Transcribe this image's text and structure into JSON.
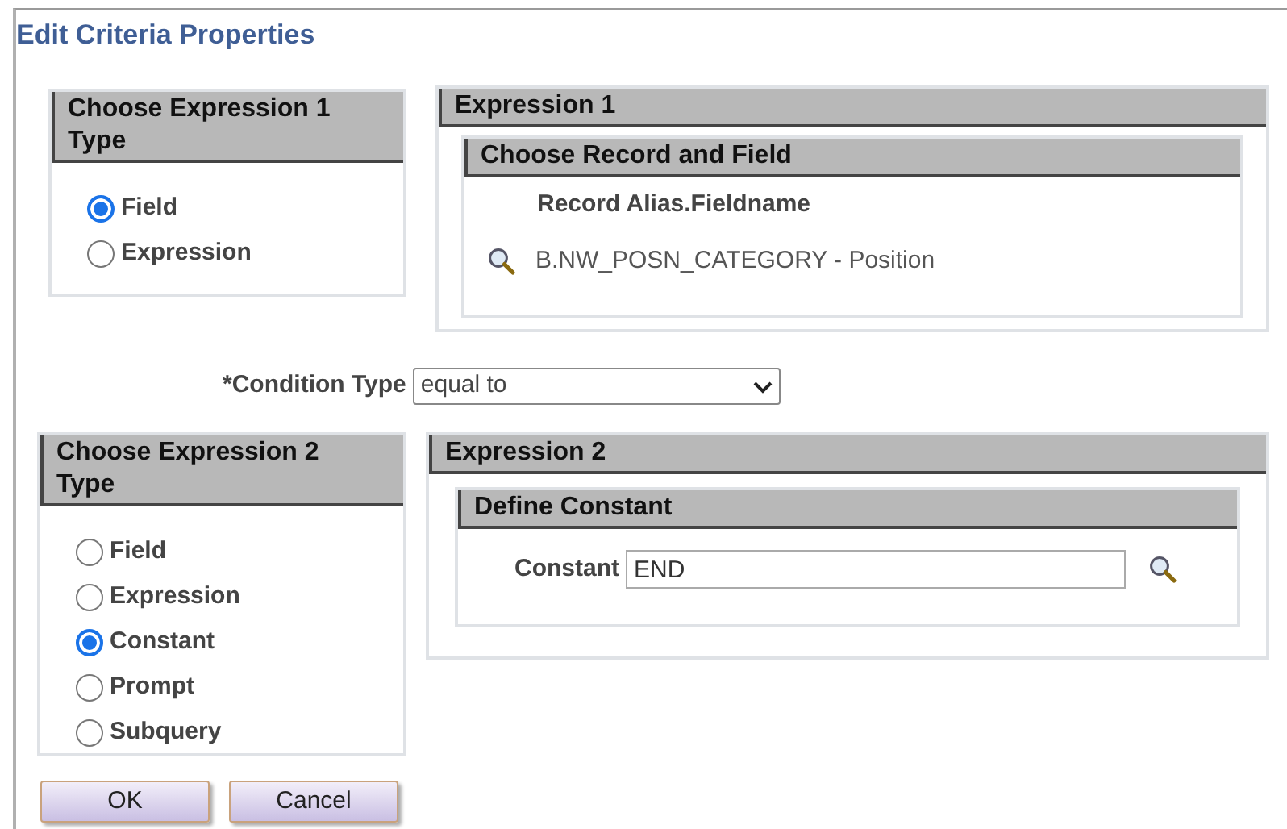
{
  "title": "Edit Criteria Properties",
  "expression_1_type": {
    "heading": "Choose Expression 1 Type",
    "options": [
      {
        "label": "Field",
        "selected": true
      },
      {
        "label": "Expression",
        "selected": false
      }
    ]
  },
  "expression_1": {
    "heading": "Expression 1",
    "section": {
      "heading": "Choose Record and Field",
      "column_label": "Record Alias.Fieldname",
      "value": "B.NW_POSN_CATEGORY - Position"
    }
  },
  "condition_type": {
    "label": "*Condition Type",
    "value": "equal to"
  },
  "expression_2_type": {
    "heading": "Choose Expression 2 Type",
    "options": [
      {
        "label": "Field",
        "selected": false
      },
      {
        "label": "Expression",
        "selected": false
      },
      {
        "label": "Constant",
        "selected": true
      },
      {
        "label": "Prompt",
        "selected": false
      },
      {
        "label": "Subquery",
        "selected": false
      }
    ]
  },
  "expression_2": {
    "heading": "Expression 2",
    "section": {
      "heading": "Define Constant",
      "label": "Constant",
      "value": "END"
    }
  },
  "buttons": [
    "OK",
    "Cancel"
  ]
}
